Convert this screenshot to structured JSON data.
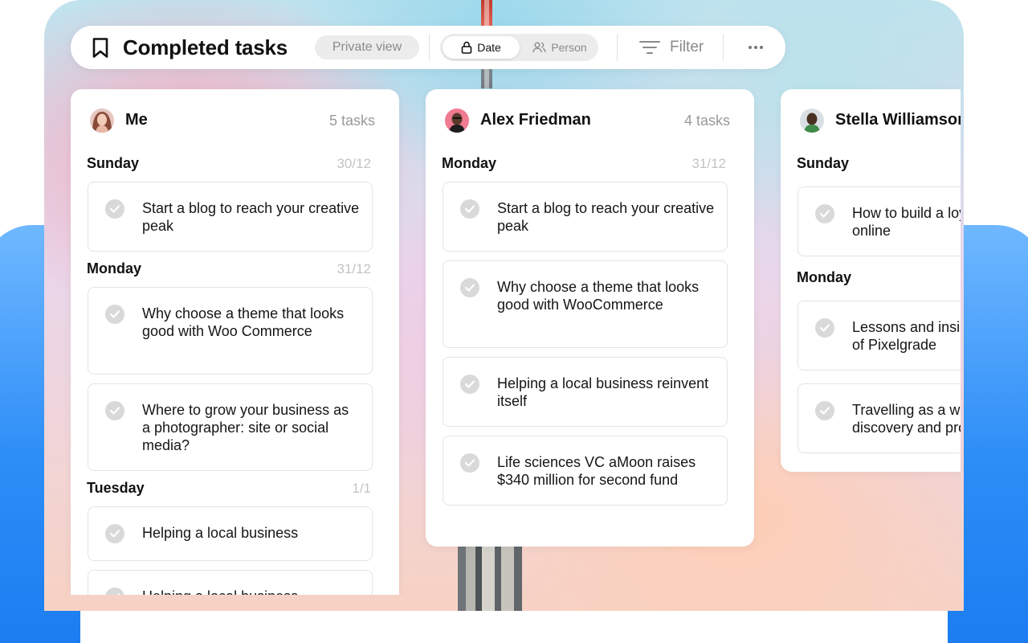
{
  "toolbar": {
    "title": "Completed tasks",
    "private_view_label": "Private view",
    "segment_date_label": "Date",
    "segment_person_label": "Person",
    "filter_label": "Filter"
  },
  "columns": [
    {
      "user": "Me",
      "task_count": "5 tasks",
      "groups": [
        {
          "day": "Sunday",
          "date": "30/12",
          "tasks": [
            "Start a blog to reach your creative peak"
          ]
        },
        {
          "day": "Monday",
          "date": "31/12",
          "tasks": [
            "Why choose a theme that looks good with Woo Commerce",
            "Where to grow your business as a photographer: site or social media?"
          ]
        },
        {
          "day": "Tuesday",
          "date": "1/1",
          "tasks": [
            "Helping a local business",
            "Helping a local business"
          ]
        }
      ]
    },
    {
      "user": "Alex Friedman",
      "task_count": "4 tasks",
      "groups": [
        {
          "day": "Monday",
          "date": "31/12",
          "tasks": [
            "Start a blog to reach your creative peak",
            "Why choose a theme that looks good with WooCommerce",
            "Helping a local business reinvent itself",
            "Life sciences VC aMoon raises $340 million for second fund"
          ]
        }
      ]
    },
    {
      "user": "Stella Williamson",
      "groups": [
        {
          "day": "Sunday",
          "tasks": [
            "How to build a loyal community online"
          ]
        },
        {
          "day": "Monday",
          "tasks": [
            "Lessons and insights from years of Pixelgrade",
            "Travelling as a way of self-discovery and progress"
          ]
        }
      ]
    }
  ],
  "colors": {
    "accent": "#111111",
    "muted_text": "#9a9a9a",
    "check_circle": "#d9d9d9",
    "side_blue": "#2e8ef7"
  }
}
